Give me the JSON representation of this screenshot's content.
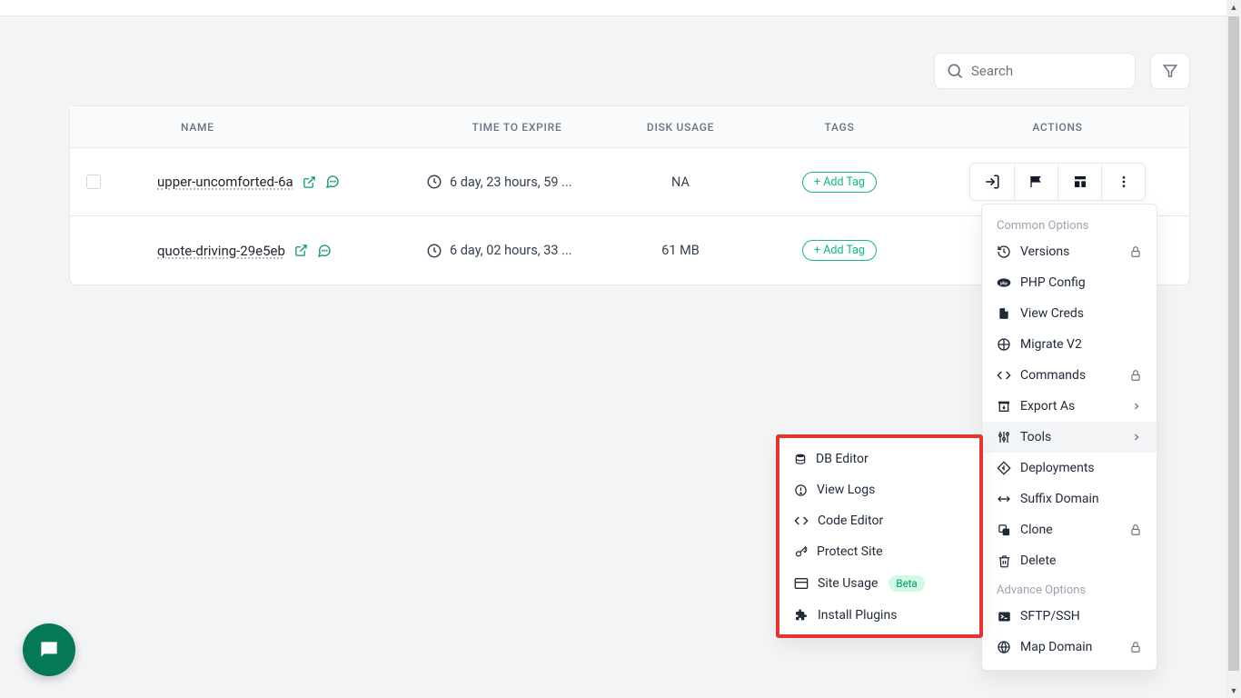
{
  "search": {
    "placeholder": "Search"
  },
  "columns": {
    "name": "NAME",
    "time": "TIME TO EXPIRE",
    "disk": "DISK USAGE",
    "tags": "TAGS",
    "actions": "ACTIONS"
  },
  "rows": [
    {
      "name": "upper-uncomforted-6a",
      "time": "6 day, 23 hours, 59 ...",
      "disk": "NA",
      "add_tag": "+ Add Tag"
    },
    {
      "name": "quote-driving-29e5eb",
      "time": "6 day, 02 hours, 33 ...",
      "disk": "61 MB",
      "add_tag": "+ Add Tag"
    }
  ],
  "menu": {
    "common_label": "Common Options",
    "advance_label": "Advance Options",
    "items": {
      "versions": {
        "label": "Versions",
        "locked": true
      },
      "phpconfig": {
        "label": "PHP Config"
      },
      "viewcreds": {
        "label": "View Creds"
      },
      "migrate": {
        "label": "Migrate V2"
      },
      "commands": {
        "label": "Commands",
        "locked": true
      },
      "exportas": {
        "label": "Export As",
        "chevron": true
      },
      "tools": {
        "label": "Tools",
        "chevron": true,
        "hovered": true
      },
      "deployments": {
        "label": "Deployments"
      },
      "suffix": {
        "label": "Suffix Domain"
      },
      "clone": {
        "label": "Clone",
        "locked": true
      },
      "delete": {
        "label": "Delete"
      },
      "sftp": {
        "label": "SFTP/SSH"
      },
      "mapdomain": {
        "label": "Map Domain",
        "locked": true
      }
    }
  },
  "submenu": {
    "dbeditor": {
      "label": "DB Editor"
    },
    "viewlogs": {
      "label": "View Logs"
    },
    "codeeditor": {
      "label": "Code Editor"
    },
    "protect": {
      "label": "Protect Site"
    },
    "siteusage": {
      "label": "Site Usage",
      "badge": "Beta"
    },
    "plugins": {
      "label": "Install Plugins"
    }
  }
}
